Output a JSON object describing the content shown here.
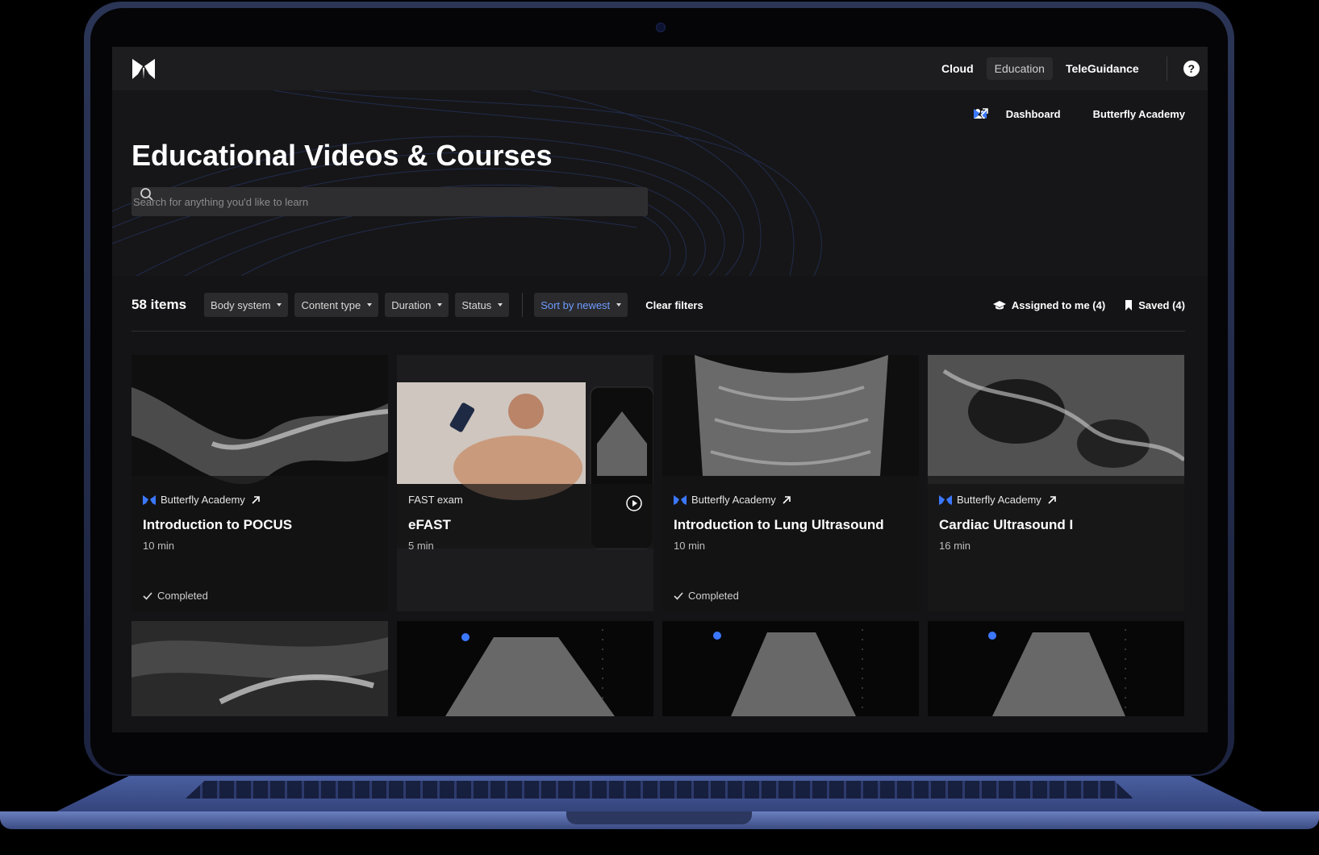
{
  "nav": {
    "items": [
      {
        "label": "Cloud",
        "active": false
      },
      {
        "label": "Education",
        "active": true
      },
      {
        "label": "TeleGuidance",
        "active": false
      }
    ],
    "help_label": "?"
  },
  "hero": {
    "dashboard_label": "Dashboard",
    "academy_label": "Butterfly Academy",
    "title": "Educational Videos & Courses",
    "search_placeholder": "Search for anything you'd like to learn"
  },
  "filters": {
    "count": "58 items",
    "chips": [
      "Body system",
      "Content type",
      "Duration",
      "Status"
    ],
    "sort": "Sort by newest",
    "clear": "Clear filters",
    "assigned": "Assigned to me (4)",
    "saved": "Saved (4)"
  },
  "cards": [
    {
      "source": "Butterfly Academy",
      "title": "Introduction to POCUS",
      "duration": "10 min",
      "status": "Completed"
    },
    {
      "source": "FAST exam",
      "title": "eFAST",
      "duration": "5 min",
      "status": ""
    },
    {
      "source": "Butterfly Academy",
      "title": "Introduction to Lung Ultrasound",
      "duration": "10 min",
      "status": "Completed"
    },
    {
      "source": "Butterfly Academy",
      "title": "Cardiac Ultrasound I",
      "duration": "16 min",
      "status": ""
    }
  ],
  "colors": {
    "accent": "#6d9bff",
    "brand": "#2f6bff",
    "background": "#141416"
  },
  "icons": [
    "butterfly-logo-icon",
    "help-icon",
    "user-icon",
    "external-link-icon",
    "search-icon",
    "graduation-cap-icon",
    "bookmark-icon",
    "check-icon",
    "play-icon"
  ]
}
